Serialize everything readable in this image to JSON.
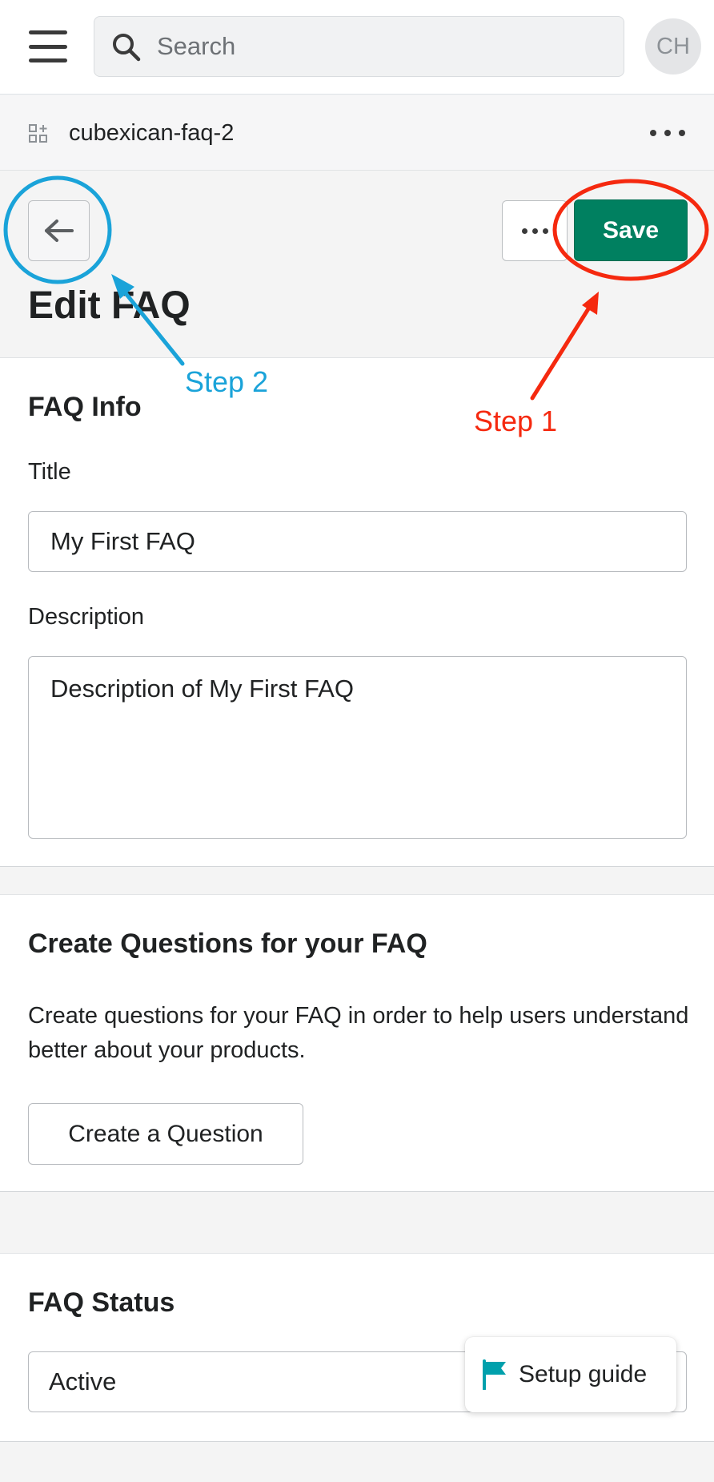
{
  "topbar": {
    "search_placeholder": "Search",
    "avatar_initials": "CH"
  },
  "appbar": {
    "app_name": "cubexican-faq-2"
  },
  "header": {
    "title": "Edit FAQ",
    "save_label": "Save"
  },
  "faq_info": {
    "heading": "FAQ Info",
    "title_label": "Title",
    "title_value": "My First FAQ",
    "description_label": "Description",
    "description_value": "Description of My First FAQ"
  },
  "questions": {
    "heading": "Create Questions for your FAQ",
    "body": "Create questions for your FAQ in order to help users understand better about your products.",
    "button_label": "Create a Question"
  },
  "status": {
    "heading": "FAQ Status",
    "selected": "Active"
  },
  "setup_guide": {
    "label": "Setup guide"
  },
  "annotations": {
    "step1": "Step 1",
    "step2": "Step 2",
    "step1_color": "#f5290f",
    "step2_color": "#1aa3d9"
  },
  "colors": {
    "primary": "#008060",
    "flag": "#00a0ac"
  }
}
